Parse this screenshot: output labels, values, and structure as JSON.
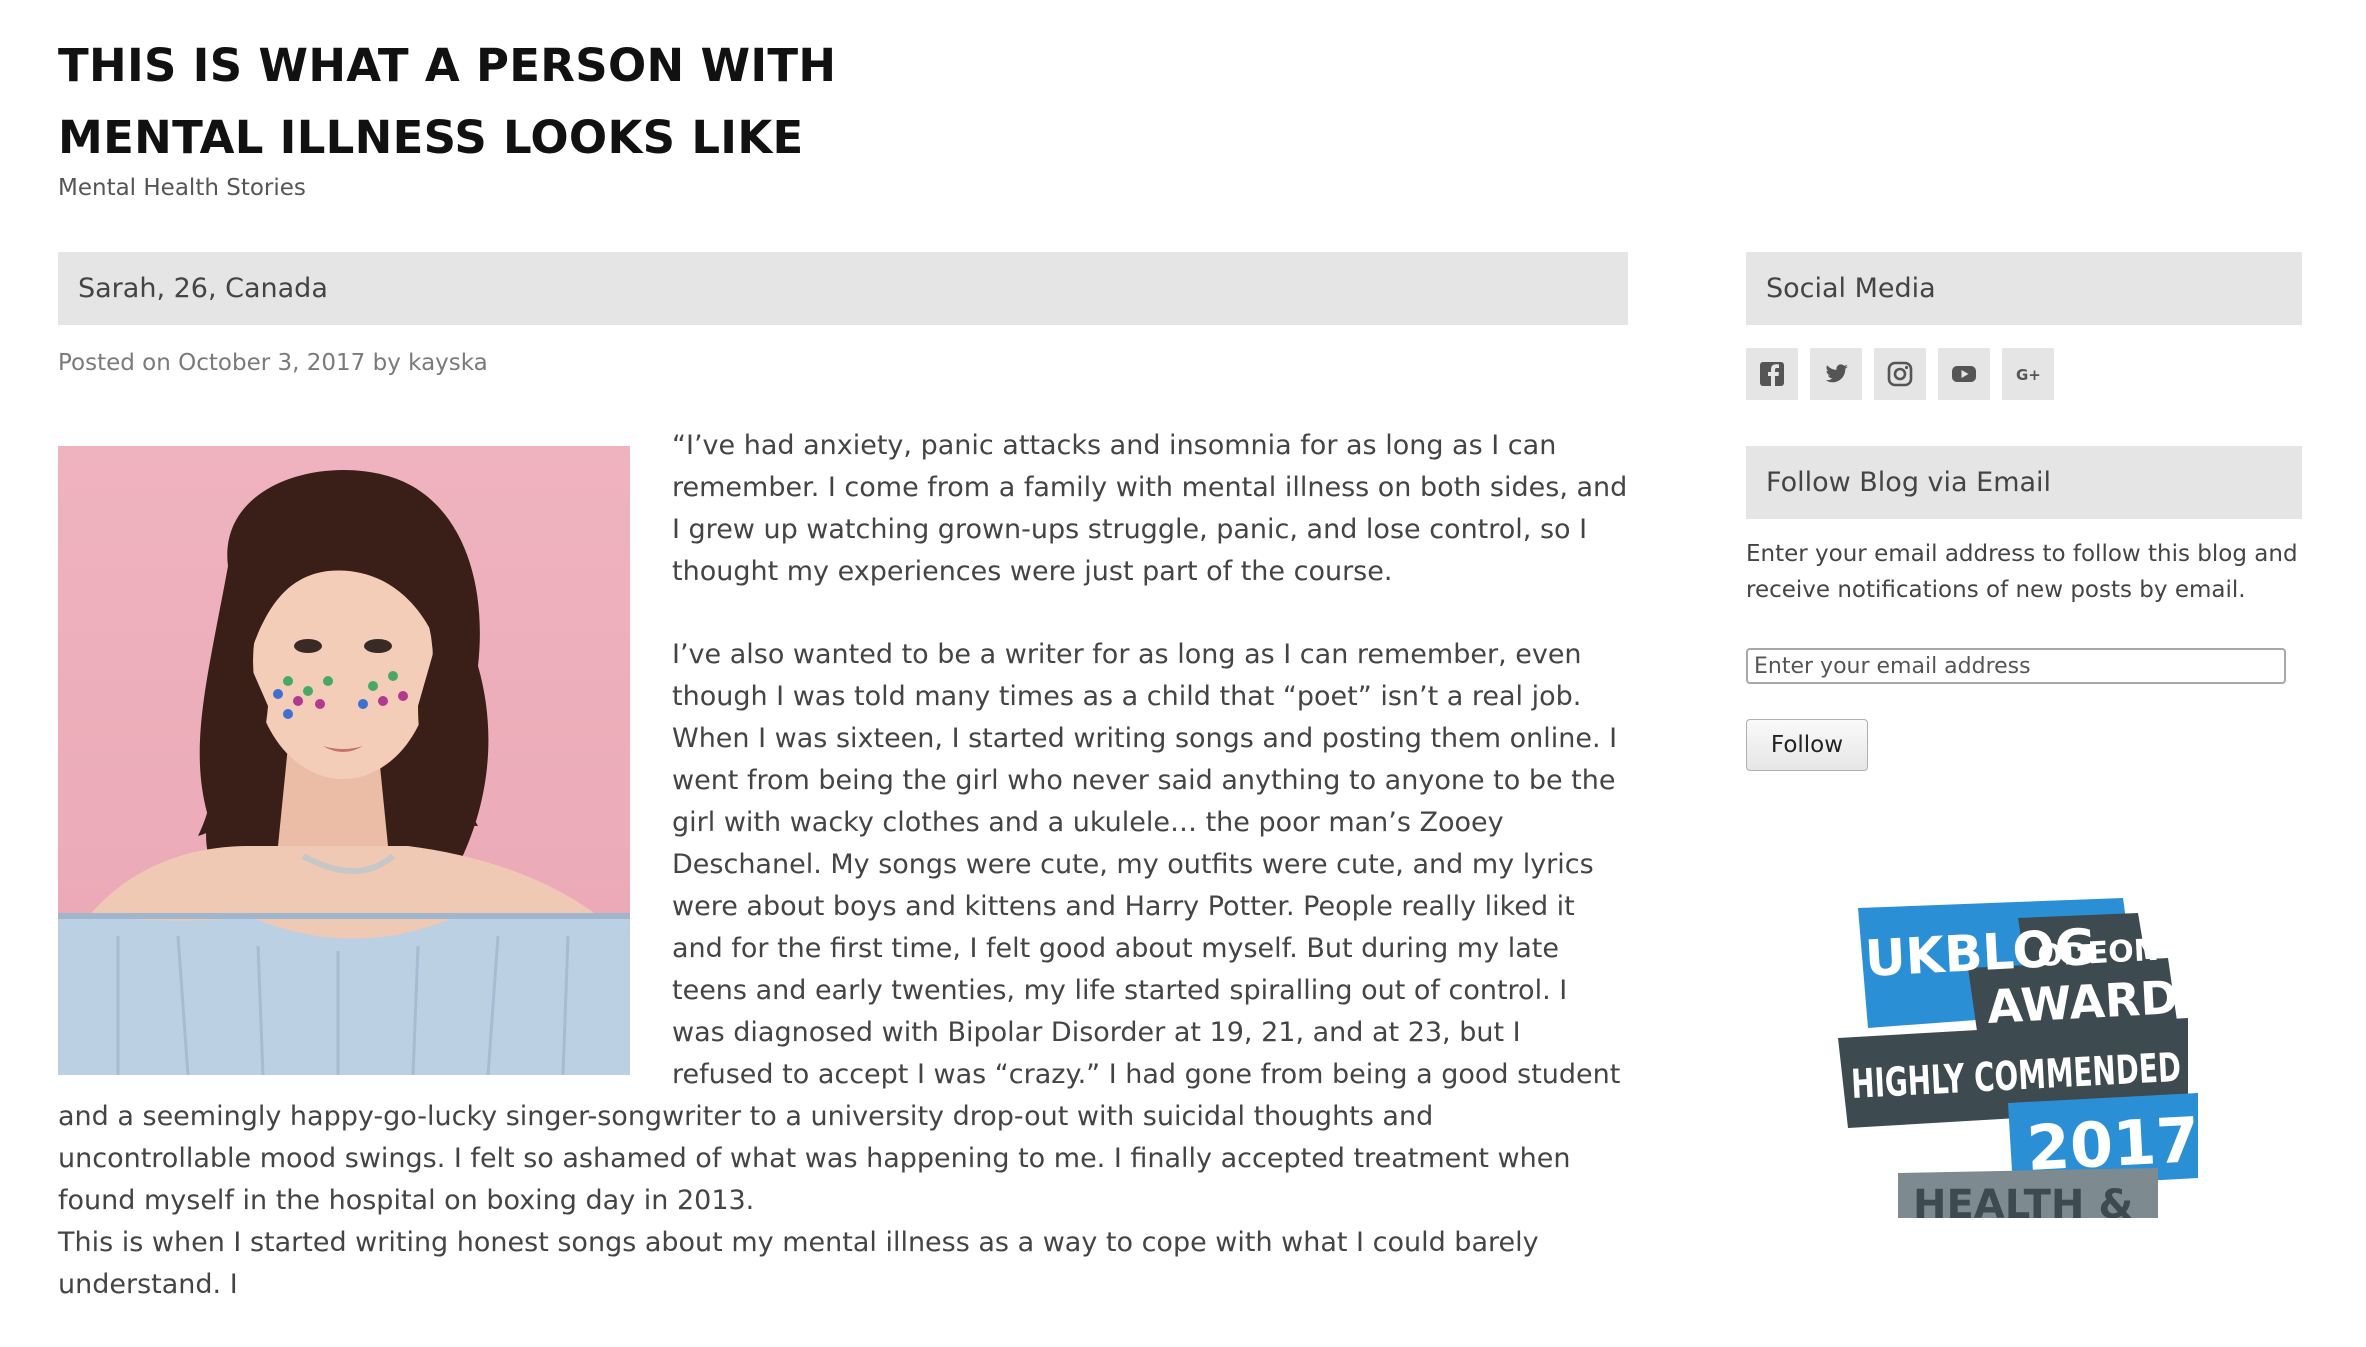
{
  "site": {
    "title": "THIS IS WHAT A PERSON WITH MENTAL ILLNESS LOOKS LIKE",
    "description": "Mental Health Stories"
  },
  "post": {
    "title": "Sarah, 26, Canada",
    "meta_prefix": "Posted on",
    "date": "October 3, 2017",
    "meta_by": "by",
    "author": "kayska",
    "paragraphs": [
      "“I’ve had anxiety, panic attacks and insomnia for as long as I can remember. I come from a family with mental illness on both sides, and I grew up watching grown-ups struggle, panic, and lose control, so I thought my experiences were just part of the course.",
      "I’ve also wanted to be a writer for as long as I can remember, even though I was told many times as a child that “poet” isn’t a real job. When I was sixteen, I started writing songs and posting them online. I went from being the girl who never said anything to anyone to be the girl with wacky clothes and a ukulele… the poor man’s Zooey Deschanel. My songs were cute, my outfits were cute, and my lyrics were about boys and kittens and Harry Potter. People really liked it and for the first time, I felt good about myself. But during my late teens and early twenties, my life started spiralling out of control. I was diagnosed with Bipolar Disorder at 19, 21, and at 23, but I refused to accept I was “crazy.” I had gone from being a good student and a seemingly happy-go-lucky singer-songwriter to a university drop-out with suicidal thoughts and uncontrollable mood swings. I felt so ashamed of what was happening to me. I finally accepted treatment when found myself in the hospital on boxing day in 2013.",
      "This is when I started writing honest songs about my mental illness as a way to cope with what I could barely understand. I"
    ]
  },
  "sidebar": {
    "social_title": "Social Media",
    "social_icons": [
      "facebook-icon",
      "twitter-icon",
      "instagram-icon",
      "youtube-icon",
      "google-plus-icon"
    ],
    "follow_title": "Follow Blog via Email",
    "follow_text": "Enter your email address to follow this blog and receive notifications of new posts by email.",
    "email_placeholder": "Enter your email address",
    "follow_button": "Follow",
    "badge": {
      "line1": "UKBLOG",
      "powered": "ODEON",
      "line2": "AWARDS",
      "line3": "HIGHLY COMMENDED",
      "year": "2017",
      "category": "HEALTH &"
    }
  },
  "colors": {
    "header_bg": "#e5e5e5",
    "badge_blue": "#2b8fd6",
    "badge_dark": "#3d4a4f"
  }
}
